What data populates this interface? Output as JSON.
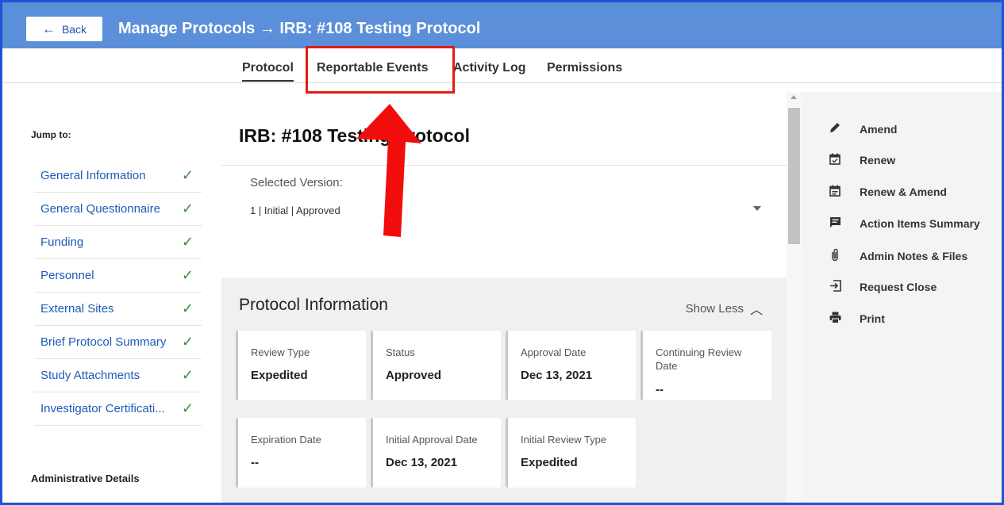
{
  "header": {
    "back_label": "Back",
    "title": "Manage Protocols → IRB: #108 Testing Protocol"
  },
  "tabs": [
    {
      "label": "Protocol",
      "active": true
    },
    {
      "label": "Reportable Events"
    },
    {
      "label": "Activity Log"
    },
    {
      "label": "Permissions"
    }
  ],
  "sidebar": {
    "jump_label": "Jump to:",
    "items": [
      {
        "label": "General Information"
      },
      {
        "label": "General Questionnaire"
      },
      {
        "label": "Funding"
      },
      {
        "label": "Personnel"
      },
      {
        "label": "External Sites"
      },
      {
        "label": "Brief Protocol Summary"
      },
      {
        "label": "Study Attachments"
      },
      {
        "label": "Investigator Certificati..."
      }
    ],
    "admin_label": "Administrative Details"
  },
  "main": {
    "protocol_title": "IRB: #108 Testing Protocol",
    "version_label": "Selected Version:",
    "version_value": "1 | Initial | Approved",
    "info_title": "Protocol Information",
    "show_less": "Show Less",
    "cards": [
      {
        "label": "Review Type",
        "value": "Expedited"
      },
      {
        "label": "Status",
        "value": "Approved"
      },
      {
        "label": "Approval Date",
        "value": "Dec 13, 2021"
      },
      {
        "label": "Continuing Review Date",
        "value": "--"
      },
      {
        "label": "Expiration Date",
        "value": "--"
      },
      {
        "label": "Initial Approval Date",
        "value": "Dec 13, 2021"
      },
      {
        "label": "Initial Review Type",
        "value": "Expedited"
      }
    ]
  },
  "actions": [
    {
      "label": "Amend",
      "icon": "pencil-icon"
    },
    {
      "label": "Renew",
      "icon": "calendar-check-icon"
    },
    {
      "label": "Renew & Amend",
      "icon": "calendar-edit-icon"
    },
    {
      "label": "Action Items Summary",
      "icon": "comment-icon"
    },
    {
      "label": "Admin Notes & Files",
      "icon": "paperclip-icon"
    },
    {
      "label": "Request Close",
      "icon": "exit-icon"
    },
    {
      "label": "Print",
      "icon": "printer-icon"
    }
  ],
  "colors": {
    "header_bg": "#5b8fd9",
    "link": "#1e5bb8",
    "highlight": "#e11d16",
    "frame": "#1f53d6"
  }
}
